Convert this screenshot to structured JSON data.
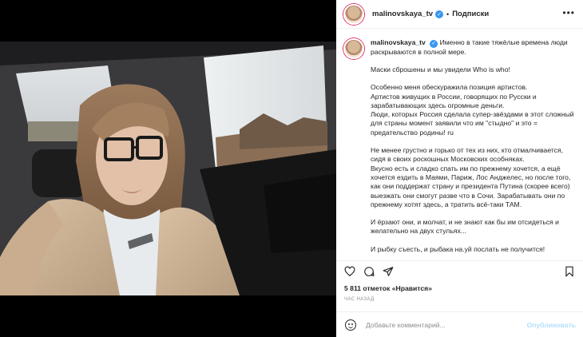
{
  "header": {
    "username": "malinovskaya_tv",
    "verified_glyph": "✓",
    "separator": "•",
    "follow_label": "Подписки"
  },
  "caption": {
    "username": "malinovskaya_tv",
    "paragraphs": [
      [
        "Именно в такие тяжёлые времена люди",
        "раскрываются в полной мере."
      ],
      [
        "Маски сброшены и мы увидели Who is who!"
      ],
      [
        "Особенно меня обескуражила позиция артистов.",
        "Артистов живущих в России, говорящих по Русски и",
        "зарабатывающих здесь огромные деньги.",
        "Люди, которых Россия сделала супер-звёздами в этот сложный",
        "для страны момент заявили что им \"стыдно\" и это =",
        "предательство родины! ru"
      ],
      [
        "Не менее грустно и горько от тех из них, кто отмалчивается,",
        "сидя в своих роскошных Московских особняках.",
        "Вкусно есть и сладко спать им по прежнему хочется, а ещё",
        "хочется ездить в Маями, Париж, Лос Анджелес, но после того,",
        "как они поддержат страну и президента Путина (скорее всего)",
        "выезжать они смогут разве что в Сочи. Зарабатывать они по",
        "прежнему хотят здесь, а тратить всё-таки ТАМ."
      ],
      [
        "И ёрзают они, и молчат, и не знают как бы им отсидеться и",
        "желательно на двух стульях..."
      ],
      [
        "И рыбку съесть, и рыбака на.уй послать не получится!"
      ]
    ]
  },
  "actions": {
    "icons": [
      "heart-icon",
      "comment-icon",
      "share-icon",
      "bookmark-icon"
    ]
  },
  "likes": {
    "count": "5 811",
    "text_middle": " отметок «",
    "liked_label": "Нравится",
    "text_end": "»"
  },
  "timestamp": "ЧАС НАЗАД",
  "comment": {
    "placeholder": "Добавьте комментарий...",
    "publish_label": "Опубликовать"
  },
  "colors": {
    "verified": "#3897f0",
    "publish_disabled": "#b2dffc",
    "avatar_ring": "#e1306c"
  }
}
